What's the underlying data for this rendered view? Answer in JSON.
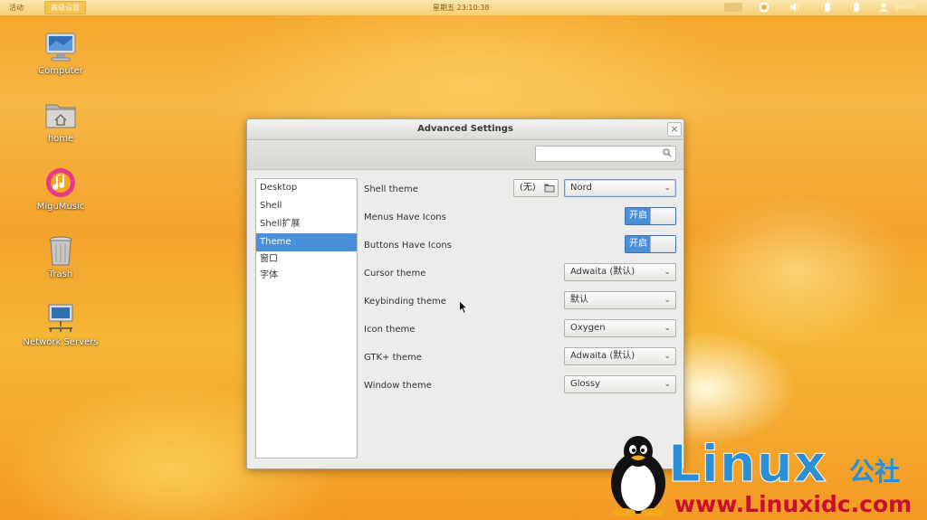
{
  "panel": {
    "activities": "活动",
    "app_name": "高级设置",
    "clock": "星期五 23:10:38",
    "user": "gavin"
  },
  "desktop": {
    "icons": [
      {
        "label": "Computer",
        "icon": "computer-icon"
      },
      {
        "label": "home",
        "icon": "home-folder-icon"
      },
      {
        "label": "MiguMusic",
        "icon": "music-app-icon"
      },
      {
        "label": "Trash",
        "icon": "trash-icon"
      },
      {
        "label": "Network Servers",
        "icon": "network-icon"
      }
    ]
  },
  "window": {
    "title": "Advanced Settings",
    "close_symbol": "×",
    "search": {
      "placeholder": ""
    },
    "categories": [
      "Desktop",
      "Shell",
      "Shell扩展",
      "Theme",
      "窗口",
      "字体"
    ],
    "selected_category": "Theme",
    "settings": {
      "shell_theme": {
        "label": "Shell theme",
        "none_button": "(无)",
        "value": "Nord"
      },
      "menus_have_icons": {
        "label": "Menus Have Icons",
        "state": "开启"
      },
      "buttons_have_icons": {
        "label": "Buttons Have Icons",
        "state": "开启"
      },
      "cursor_theme": {
        "label": "Cursor theme",
        "value": "Adwaita (默认)"
      },
      "keybinding_theme": {
        "label": "Keybinding theme",
        "value": "默认"
      },
      "icon_theme": {
        "label": "Icon theme",
        "value": "Oxygen"
      },
      "gtk_theme": {
        "label": "GTK+ theme",
        "value": "Adwaita (默认)"
      },
      "window_theme": {
        "label": "Window theme",
        "value": "Glossy"
      }
    },
    "accent_color": "#4a90d9"
  },
  "watermark": {
    "brand": "Linux",
    "brand_cn": "公社",
    "url": "www.Linuxidc.com"
  }
}
